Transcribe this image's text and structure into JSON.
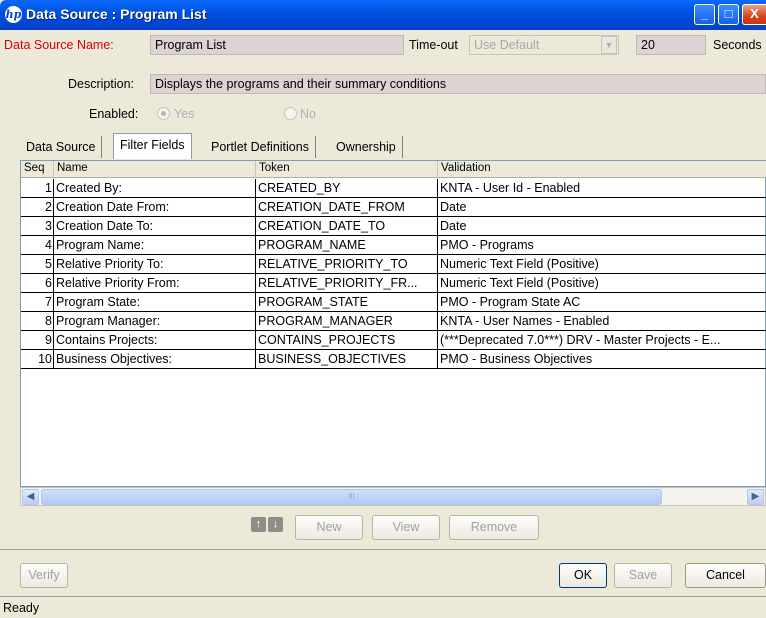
{
  "window": {
    "title": "Data Source : Program List",
    "logo_text": "hp",
    "minimize": "_",
    "maximize": "□",
    "close": "X"
  },
  "form": {
    "data_source_name_label": "Data Source Name:",
    "data_source_name_value": "Program List",
    "timeout_label": "Time-out",
    "timeout_option": "Use Default",
    "timeout_value": "20",
    "timeout_unit": "Seconds",
    "description_label": "Description:",
    "description_value": "Displays the programs and their summary conditions",
    "enabled_label": "Enabled:",
    "enabled_yes": "Yes",
    "enabled_no": "No",
    "colors": {
      "required_label": "#e00000",
      "field_bg": "#ddd3d3"
    }
  },
  "tabs": [
    {
      "label": "Data Source",
      "active": false
    },
    {
      "label": "Filter Fields",
      "active": true
    },
    {
      "label": "Portlet Definitions",
      "active": false
    },
    {
      "label": "Ownership",
      "active": false
    }
  ],
  "table": {
    "headers": [
      "Seq",
      "Name",
      "Token",
      "Validation"
    ],
    "rows": [
      {
        "seq": "1",
        "name": "Created By:",
        "token": "CREATED_BY",
        "validation": "KNTA - User Id - Enabled"
      },
      {
        "seq": "2",
        "name": "Creation Date From:",
        "token": "CREATION_DATE_FROM",
        "validation": "Date"
      },
      {
        "seq": "3",
        "name": "Creation Date To:",
        "token": "CREATION_DATE_TO",
        "validation": "Date"
      },
      {
        "seq": "4",
        "name": "Program Name:",
        "token": "PROGRAM_NAME",
        "validation": "PMO - Programs"
      },
      {
        "seq": "5",
        "name": "Relative Priority To:",
        "token": "RELATIVE_PRIORITY_TO",
        "validation": "Numeric Text Field (Positive)"
      },
      {
        "seq": "6",
        "name": "Relative Priority From:",
        "token": "RELATIVE_PRIORITY_FR...",
        "validation": "Numeric Text Field (Positive)"
      },
      {
        "seq": "7",
        "name": "Program State:",
        "token": "PROGRAM_STATE",
        "validation": "PMO - Program State AC"
      },
      {
        "seq": "8",
        "name": "Program Manager:",
        "token": "PROGRAM_MANAGER",
        "validation": "KNTA - User Names - Enabled"
      },
      {
        "seq": "9",
        "name": "Contains Projects:",
        "token": "CONTAINS_PROJECTS",
        "validation": "(***Deprecated 7.0***) DRV - Master Projects - E..."
      },
      {
        "seq": "10",
        "name": "Business Objectives:",
        "token": "BUSINESS_OBJECTIVES",
        "validation": "PMO - Business Objectives"
      }
    ]
  },
  "scrollbar": {
    "thumb_grip": "III"
  },
  "row_actions": {
    "move_up_icon": "↑",
    "move_down_icon": "↓",
    "new_label": "New",
    "view_label": "View",
    "remove_label": "Remove"
  },
  "footer": {
    "verify_label": "Verify",
    "ok_label": "OK",
    "save_label": "Save",
    "cancel_label": "Cancel"
  },
  "status": {
    "text": "Ready"
  }
}
